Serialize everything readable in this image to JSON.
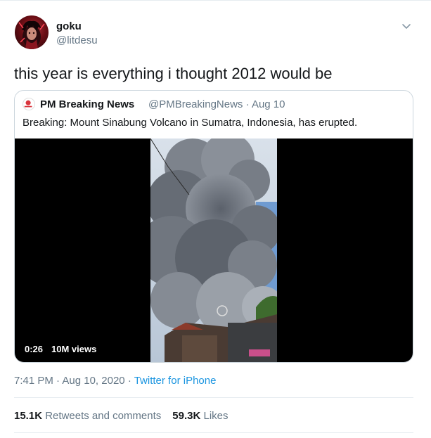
{
  "author": {
    "display_name": "goku",
    "handle": "@litdesu"
  },
  "tweet": {
    "text": "this year is everything i thought 2012 would be"
  },
  "quoted_tweet": {
    "display_name": "PM Breaking News",
    "handle": "@PMBreakingNews",
    "date": "Aug 10",
    "text": "Breaking: Mount Sinabung Volcano in Sumatra, Indonesia, has erupted.",
    "video": {
      "time": "0:26",
      "views": "10M views"
    }
  },
  "meta": {
    "time": "7:41 PM",
    "date": "Aug 10, 2020",
    "source": "Twitter for iPhone",
    "separator": "·"
  },
  "stats": {
    "retweets_count": "15.1K",
    "retweets_label": "Retweets and comments",
    "likes_count": "59.3K",
    "likes_label": "Likes"
  },
  "icons": {
    "caret": "chevron-down-icon"
  },
  "colors": {
    "link": "#1b95e0",
    "secondary_text": "#657786",
    "primary_text": "#14171a",
    "border": "#e6ecf0"
  }
}
